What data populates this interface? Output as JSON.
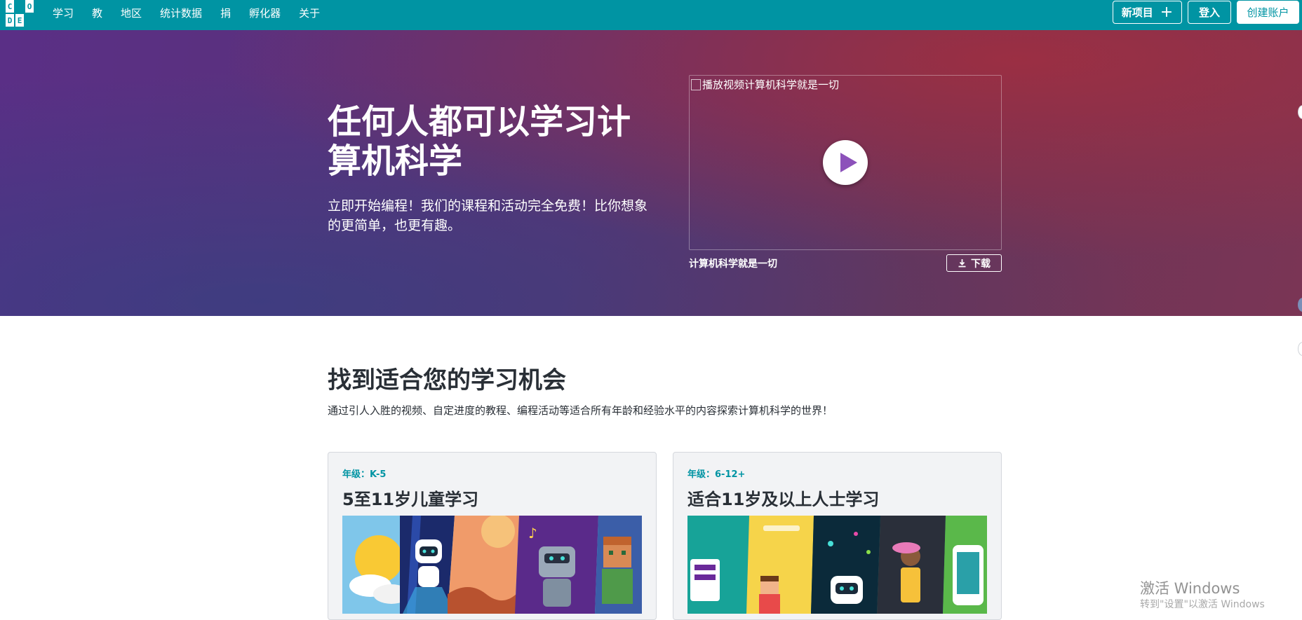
{
  "header": {
    "logo_letters": [
      "C",
      "O",
      "D",
      "E"
    ],
    "nav": [
      "学习",
      "教",
      "地区",
      "统计数据",
      "捐",
      "孵化器",
      "关于"
    ],
    "new_project_label": "新项目",
    "login_label": "登入",
    "signup_label": "创建账户"
  },
  "hero": {
    "title": "任何人都可以学习计算机科学",
    "subtitle": "立即开始编程！我们的课程和活动完全免费！比你想象的更简单，也更有趣。",
    "video_alt": "播放视频计算机科学就是一切",
    "video_caption": "计算机科学就是一切",
    "download_label": "下载"
  },
  "learning": {
    "title": "找到适合您的学习机会",
    "description": "通过引人入胜的视频、自定进度的教程、编程活动等适合所有年龄和经验水平的内容探索计算机科学的世界！",
    "cards": [
      {
        "grade": "年级：K-5",
        "title": "5至11岁儿童学习"
      },
      {
        "grade": "年级：6-12+",
        "title": "适合11岁及以上人士学习"
      }
    ]
  },
  "watermark": {
    "title": "激活 Windows",
    "subtitle": "转到\"设置\"以激活 Windows"
  },
  "colors": {
    "brand_teal": "#0094a3",
    "play_purple": "#8c52ba",
    "text_dark": "#292f36"
  }
}
